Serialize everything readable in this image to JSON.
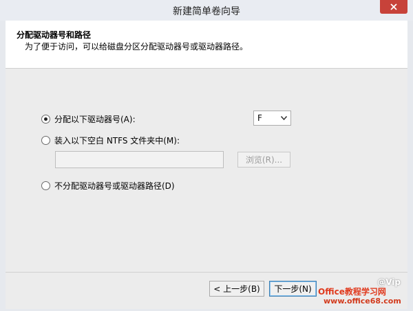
{
  "window": {
    "title": "新建简单卷向导"
  },
  "header": {
    "title": "分配驱动器号和路径",
    "subtitle": "为了便于访问，可以给磁盘分区分配驱动器号或驱动器路径。"
  },
  "options": {
    "assign_label": "分配以下驱动器号(A):",
    "assign_checked": true,
    "drive_letter": "F",
    "mount_label": "装入以下空白 NTFS 文件夹中(M):",
    "mount_path_value": "",
    "browse_label": "浏览(R)...",
    "none_label": "不分配驱动器号或驱动器路径(D)"
  },
  "buttons": {
    "back_label": "< 上一步(B)",
    "next_label": "下一步(N)"
  },
  "watermark": {
    "top": "@Vip",
    "brand": "Office教程学习网",
    "url": "www.office68.com"
  },
  "icons": {
    "close": "close-icon",
    "dropdown": "chevron-down-icon"
  }
}
